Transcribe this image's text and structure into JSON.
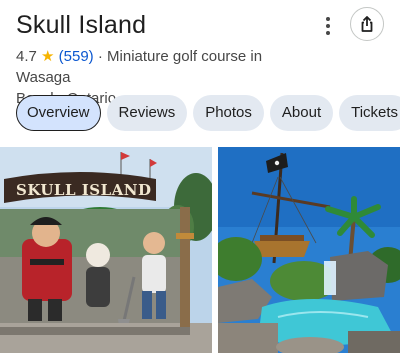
{
  "place": {
    "title": "Skull Island",
    "rating": "4.7",
    "review_count": "(559)",
    "separator": "·",
    "category_line": "Miniature golf course in Wasaga",
    "location_line": "Beach, Ontario"
  },
  "actions": {
    "more_icon": "more-vert-icon",
    "share_icon": "share-icon"
  },
  "tabs": [
    {
      "label": "Overview",
      "active": true
    },
    {
      "label": "Reviews",
      "active": false
    },
    {
      "label": "Photos",
      "active": false
    },
    {
      "label": "About",
      "active": false
    },
    {
      "label": "Tickets",
      "active": false
    }
  ],
  "photos": {
    "left_sign_text": "SKULL ISLAND"
  },
  "colors": {
    "star": "#f6b400",
    "link": "#0b57d0",
    "chip_bg": "#e3e9f1",
    "chip_active_bg": "#d3e3fd"
  }
}
